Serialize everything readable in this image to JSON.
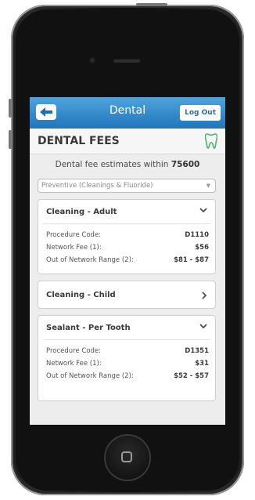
{
  "navbar": {
    "title": "Dental",
    "logout_label": "Log Out"
  },
  "page": {
    "title": "DENTAL FEES",
    "subtitle_prefix": "Dental fee estimates within",
    "zip": "75600",
    "select_value": "Preventive (Cleanings & Fluoride)"
  },
  "cards": [
    {
      "title": "Cleaning - Adult",
      "expanded": true,
      "rows": [
        {
          "label": "Procedure Code:",
          "value": "D1110"
        },
        {
          "label": "Network Fee (1):",
          "value": "$56"
        },
        {
          "label": "Out of Network Range (2):",
          "value": "$81 - $87"
        }
      ]
    },
    {
      "title": "Cleaning - Child",
      "expanded": false
    },
    {
      "title": "Sealant - Per Tooth",
      "expanded": true,
      "rows": [
        {
          "label": "Procedure Code:",
          "value": "D1351"
        },
        {
          "label": "Network Fee (1):",
          "value": "$31"
        },
        {
          "label": "Out of Network Range (2):",
          "value": "$52 - $57"
        }
      ]
    }
  ],
  "icons": {
    "back": "back-arrow-icon",
    "tooth": "tooth-icon",
    "expand": "chevron-down-icon",
    "collapse": "chevron-right-icon"
  },
  "colors": {
    "nav_top": "#4fa3dd",
    "nav_bottom": "#1f76b9",
    "tooth_green": "#4db36a"
  }
}
